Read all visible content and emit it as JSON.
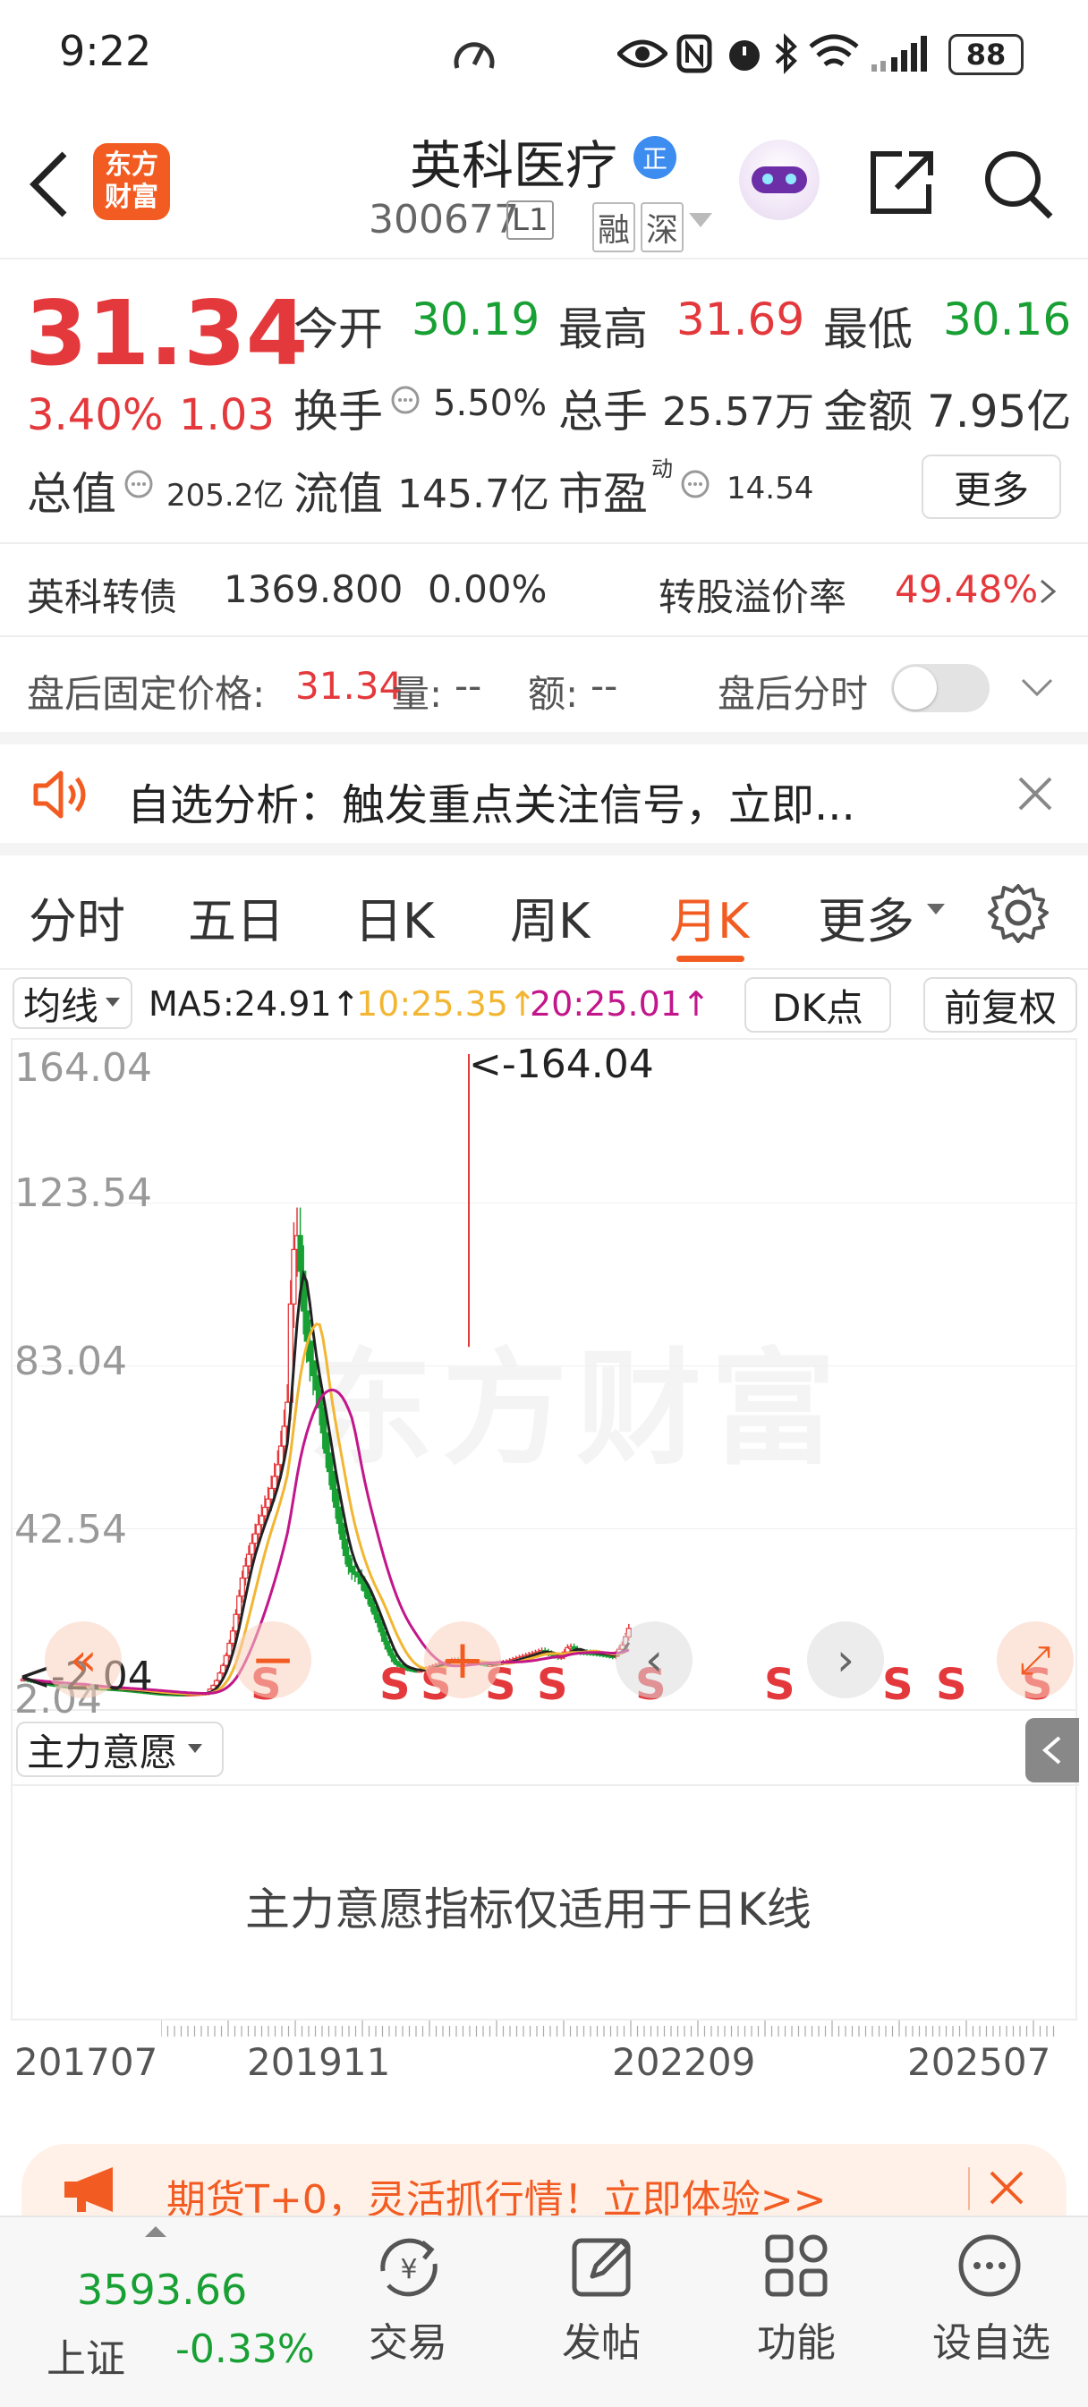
{
  "status_bar": {
    "time": "9:22",
    "battery": "88"
  },
  "header": {
    "logo_text": "东方\n财富",
    "stock_name": "英科医疗",
    "badge": "正",
    "code": "300677",
    "level": "L1",
    "tags": [
      "融",
      "深"
    ]
  },
  "quote": {
    "price": "31.34",
    "change_pct": "3.40%",
    "change": "1.03",
    "open_label": "今开",
    "open": "30.19",
    "high_label": "最高",
    "high": "31.69",
    "low_label": "最低",
    "low": "30.16",
    "turnover_label": "换手",
    "turnover": "5.50%",
    "volume_label": "总手",
    "volume": "25.57万",
    "amount_label": "金额",
    "amount": "7.95亿",
    "mktcap_label": "总值",
    "mktcap": "205.2亿",
    "float_label": "流值",
    "float": "145.7亿",
    "pe_label": "市盈",
    "pe_sup": "动",
    "pe": "14.54",
    "more_label": "更多"
  },
  "bond": {
    "name": "英科转债",
    "price": "1369.800",
    "change": "0.00%",
    "premium_label": "转股溢价率",
    "premium": "49.48%"
  },
  "after_hours": {
    "price_label": "盘后固定价格:",
    "price": "31.34",
    "vol_label": "量:",
    "vol": "--",
    "amt_label": "额:",
    "amt": "--",
    "toggle_label": "盘后分时"
  },
  "notice": {
    "text": "自选分析：触发重点关注信号，立即..."
  },
  "tabs": [
    "分时",
    "五日",
    "日K",
    "周K",
    "月K",
    "更多"
  ],
  "active_tab": "月K",
  "ma_bar": {
    "dropdown": "均线",
    "ma5": "MA5:24.91↑",
    "ma10": "10:25.35↑",
    "ma20": "20:25.01↑",
    "dk": "DK点",
    "fq": "前复权"
  },
  "chart_data": {
    "type": "candlestick",
    "y_ticks": [
      "164.04",
      "123.54",
      "83.04",
      "42.54",
      "2.04"
    ],
    "max_annotation": "<-164.04",
    "min_annotation": "<-2.04",
    "x_ticks": [
      "201707",
      "201911",
      "202209",
      "202507"
    ],
    "signal_marks": [
      "S",
      "S",
      "S",
      "S",
      "S",
      "S",
      "S",
      "S",
      "S",
      "S",
      "S"
    ],
    "watermark": "东方财富",
    "colors": {
      "up": "#e4393c",
      "down": "#18a034",
      "ma5": "#222222",
      "ma10": "#f2b632",
      "ma20": "#c2168a"
    }
  },
  "indicator": {
    "dropdown": "主力意愿",
    "message": "主力意愿指标仅适用于日K线"
  },
  "promo": {
    "text": "期货T+0，灵活抓行情！立即体验>>"
  },
  "bottom_nav": {
    "index_value": "3593.66",
    "index_name": "上证",
    "index_change": "-0.33%",
    "items": [
      "交易",
      "发帖",
      "功能",
      "设自选"
    ]
  }
}
